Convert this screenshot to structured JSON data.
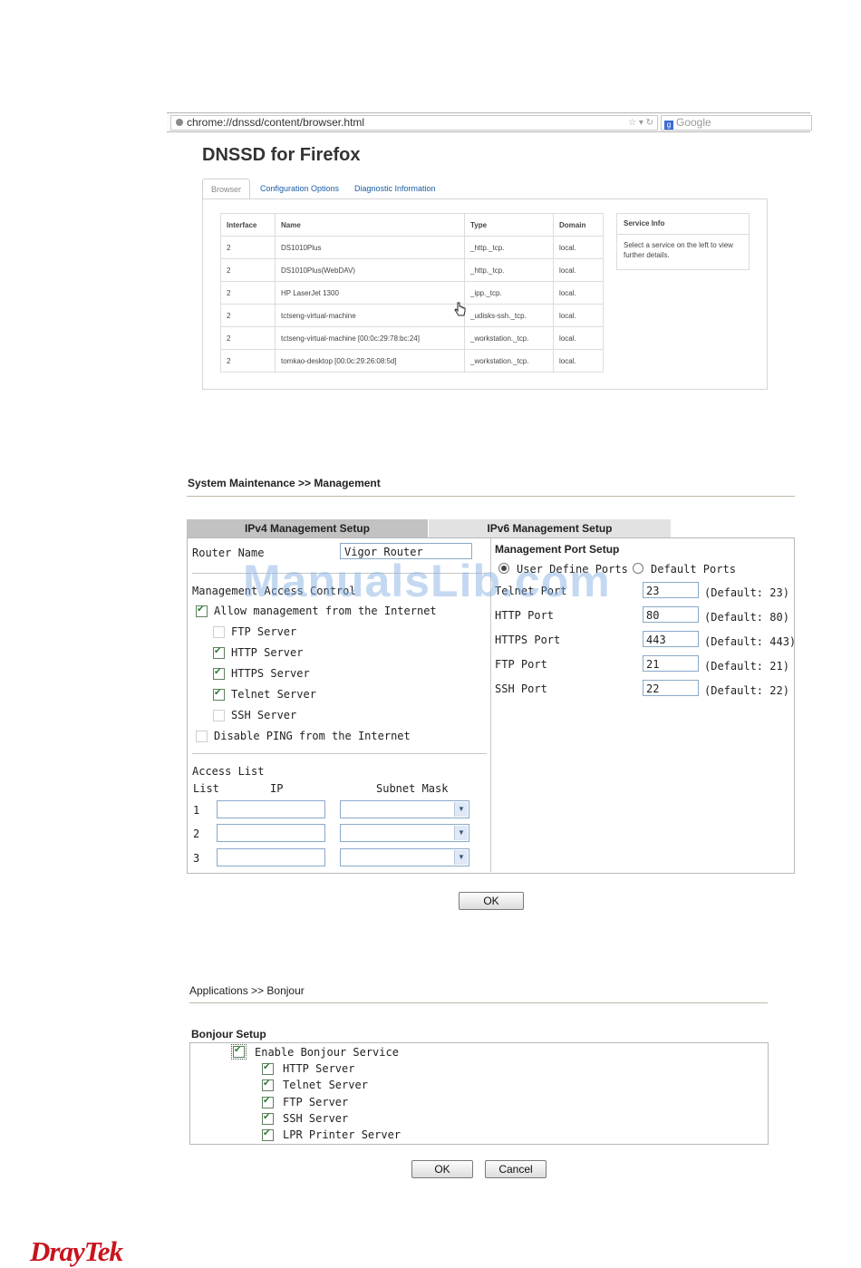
{
  "browser": {
    "url": "chrome://dnssd/content/browser.html",
    "search_placeholder": "Google",
    "page_title": "DNSSD for Firefox",
    "tabs": [
      "Browser",
      "Configuration Options",
      "Diagnostic Information"
    ],
    "table": {
      "headers": [
        "Interface",
        "Name",
        "Type",
        "Domain"
      ],
      "rows": [
        [
          "2",
          "DS1010Plus",
          "_http._tcp.",
          "local."
        ],
        [
          "2",
          "DS1010Plus(WebDAV)",
          "_http._tcp.",
          "local."
        ],
        [
          "2",
          "HP LaserJet 1300",
          "_ipp._tcp.",
          "local."
        ],
        [
          "2",
          "tctseng-virtual-machine",
          "_udisks-ssh._tcp.",
          "local."
        ],
        [
          "2",
          "tctseng-virtual-machine [00:0c:29:78:bc:24]",
          "_workstation._tcp.",
          "local."
        ],
        [
          "2",
          "tomkao-desktop [00:0c:29:26:08:5d]",
          "_workstation._tcp.",
          "local."
        ]
      ]
    },
    "service_info": {
      "title": "Service Info",
      "text": "Select a service on the left to view further details."
    }
  },
  "management": {
    "breadcrumb": "System Maintenance >> Management",
    "tabs": [
      "IPv4 Management Setup",
      "IPv6 Management Setup"
    ],
    "router_name_label": "Router Name",
    "router_name_value": "Vigor Router",
    "access_control_title": "Management Access Control",
    "allow_internet": {
      "label": "Allow management from the Internet",
      "checked": true
    },
    "servers": [
      {
        "label": "FTP Server",
        "checked": false
      },
      {
        "label": "HTTP Server",
        "checked": true
      },
      {
        "label": "HTTPS Server",
        "checked": true
      },
      {
        "label": "Telnet Server",
        "checked": true
      },
      {
        "label": "SSH Server",
        "checked": false
      }
    ],
    "disable_ping": {
      "label": "Disable PING from the Internet",
      "checked": false
    },
    "access_list": {
      "title": "Access List",
      "col_list": "List",
      "col_ip": "IP",
      "col_mask": "Subnet Mask",
      "rows": [
        "1",
        "2",
        "3"
      ]
    },
    "port_setup": {
      "title": "Management Port Setup",
      "radio_user": "User Define Ports",
      "radio_default": "Default Ports",
      "selected": "User Define Ports",
      "ports": [
        {
          "label": "Telnet Port",
          "value": "23",
          "default": "(Default: 23)"
        },
        {
          "label": "HTTP Port",
          "value": "80",
          "default": "(Default: 80)"
        },
        {
          "label": "HTTPS Port",
          "value": "443",
          "default": "(Default: 443)"
        },
        {
          "label": "FTP Port",
          "value": "21",
          "default": "(Default: 21)"
        },
        {
          "label": "SSH Port",
          "value": "22",
          "default": "(Default: 22)"
        }
      ]
    },
    "ok_label": "OK"
  },
  "bonjour": {
    "breadcrumb": "Applications >> Bonjour",
    "setup_title": "Bonjour Setup",
    "enable": {
      "label": "Enable Bonjour Service",
      "checked": true
    },
    "services": [
      {
        "label": "HTTP Server",
        "checked": true
      },
      {
        "label": "Telnet Server",
        "checked": true
      },
      {
        "label": "FTP Server",
        "checked": true
      },
      {
        "label": "SSH Server",
        "checked": true
      },
      {
        "label": "LPR Printer Server",
        "checked": true
      }
    ],
    "ok_label": "OK",
    "cancel_label": "Cancel"
  },
  "watermark": "ManualsLib.com",
  "brand": "DrayTek",
  "colors": {
    "link": "#1a5ea8",
    "brand": "#c8141e",
    "check": "#2e7d32"
  }
}
